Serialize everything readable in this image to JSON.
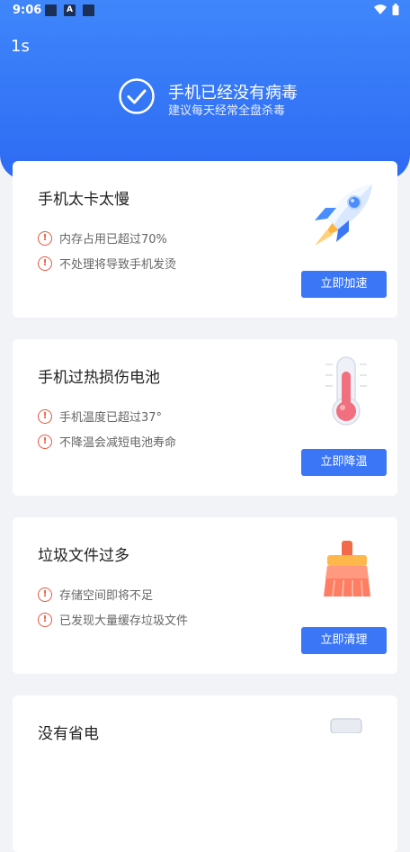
{
  "status_bar": {
    "time": "9:06"
  },
  "header": {
    "countdown": "1s",
    "title": "手机已经没有病毒",
    "subtitle": "建议每天经常全盘杀毒"
  },
  "cards": [
    {
      "title": "手机太卡太慢",
      "warnings": [
        "内存占用已超过70%",
        "不处理将导致手机发烫"
      ],
      "button": "立即加速",
      "icon": "rocket-icon"
    },
    {
      "title": "手机过热损伤电池",
      "warnings": [
        "手机温度已超过37°",
        "不降温会减短电池寿命"
      ],
      "button": "立即降温",
      "icon": "thermometer-icon"
    },
    {
      "title": "垃圾文件过多",
      "warnings": [
        "存储空间即将不足",
        "已发现大量缓存垃圾文件"
      ],
      "button": "立即清理",
      "icon": "broom-icon"
    },
    {
      "title": "没有省电",
      "icon": "battery-icon"
    }
  ],
  "colors": {
    "header_blue": "#3f86fb",
    "button_blue": "#3a76f6",
    "warning_red": "#e8573f"
  }
}
